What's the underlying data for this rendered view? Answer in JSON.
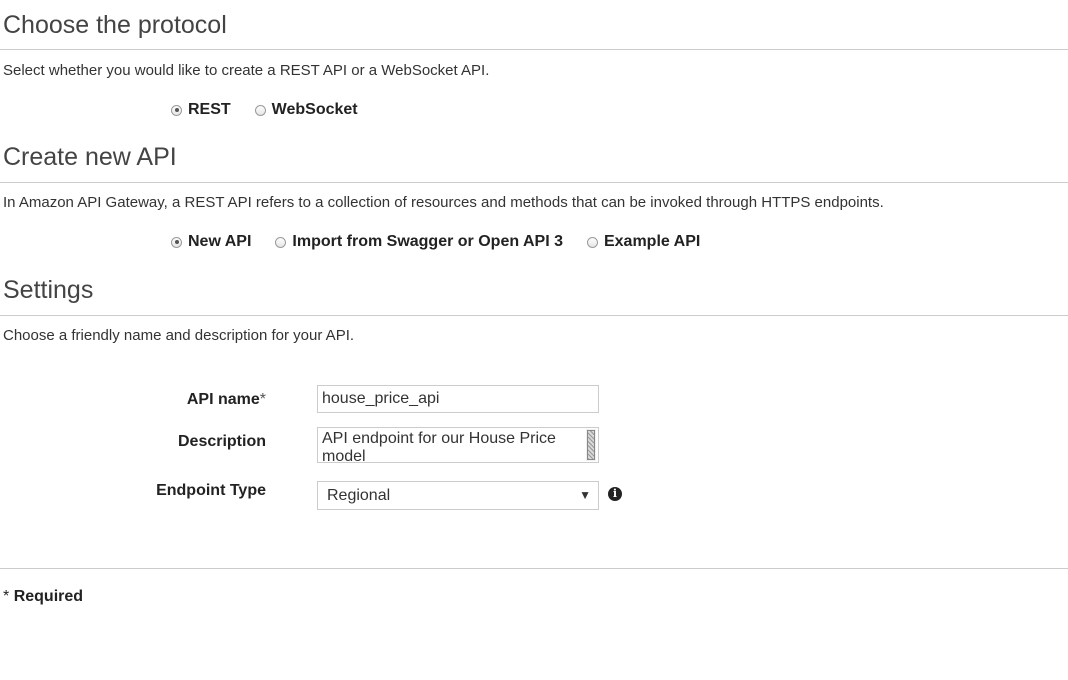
{
  "protocol": {
    "title": "Choose the protocol",
    "description": "Select whether you would like to create a REST API or a WebSocket API.",
    "options": [
      {
        "label": "REST",
        "selected": true
      },
      {
        "label": "WebSocket",
        "selected": false
      }
    ]
  },
  "create_api": {
    "title": "Create new API",
    "description": "In Amazon API Gateway, a REST API refers to a collection of resources and methods that can be invoked through HTTPS endpoints.",
    "options": [
      {
        "label": "New API",
        "selected": true
      },
      {
        "label": "Import from Swagger or Open API 3",
        "selected": false
      },
      {
        "label": "Example API",
        "selected": false
      }
    ]
  },
  "settings": {
    "title": "Settings",
    "description": "Choose a friendly name and description for your API.",
    "api_name": {
      "label": "API name",
      "required_marker": "*",
      "value": "house_price_api"
    },
    "description_field": {
      "label": "Description",
      "value": "API endpoint for our House Price model"
    },
    "endpoint_type": {
      "label": "Endpoint Type",
      "value": "Regional",
      "arrow": "▼",
      "info_icon": "i"
    }
  },
  "footer": {
    "required_marker": "*",
    "required_text": "Required"
  }
}
